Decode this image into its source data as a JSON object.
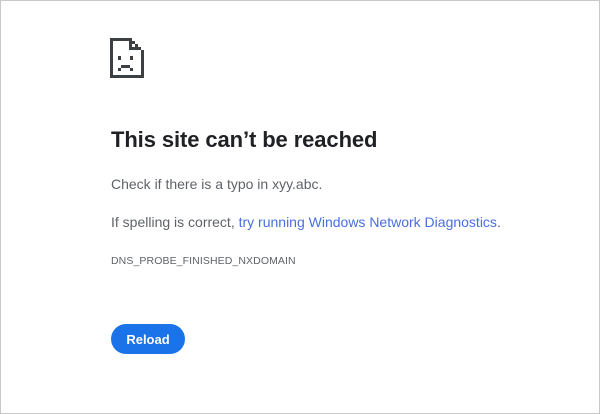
{
  "error_page": {
    "icon": "sad-document-icon",
    "title": "This site can’t be reached",
    "message_typo": "Check if there is a typo in xyy.abc.",
    "message_spelling_prefix": "If spelling is correct, ",
    "diagnostics_link": "try running Windows Network Diagnostics",
    "message_spelling_suffix": ".",
    "error_code": "DNS_PROBE_FINISHED_NXDOMAIN",
    "reload_label": "Reload"
  },
  "colors": {
    "title": "#202124",
    "body_text": "#5f6368",
    "link": "#4a6ee0",
    "button_bg": "#1a73e8",
    "button_text": "#ffffff"
  }
}
